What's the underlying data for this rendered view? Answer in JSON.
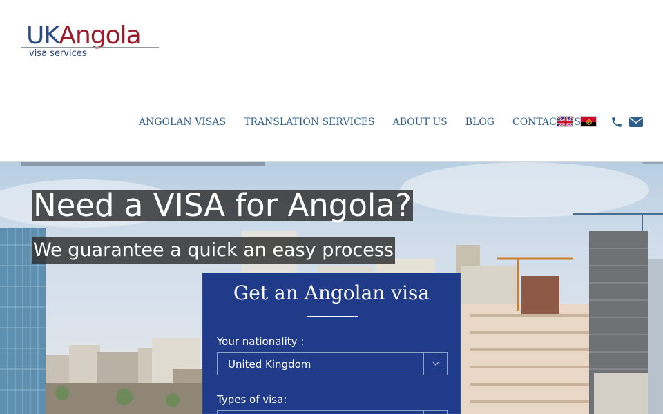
{
  "brand": {
    "logo_main_uk": "UK",
    "logo_main_angola": "Angola",
    "logo_sub": "visa services"
  },
  "nav": {
    "items": [
      "ANGOLAN VISAS",
      "TRANSLATION SERVICES",
      "ABOUT US",
      "BLOG",
      "CONTACT US"
    ]
  },
  "icons": {
    "flag_uk": "uk-flag-icon",
    "flag_angola": "angola-flag-icon",
    "phone": "phone-icon",
    "mail": "envelope-icon"
  },
  "hero": {
    "title": "Need a VISA for Angola?",
    "subtitle": "We guarantee a quick an easy process"
  },
  "visa_form": {
    "title": "Get an Angolan visa",
    "nationality_label": "Your nationality :",
    "nationality_value": "United Kingdom",
    "type_label": "Types of visa:",
    "type_value": ""
  },
  "colors": {
    "nav_text": "#2d5f8c",
    "form_bg": "#1f3b8a",
    "logo_blue": "#2a4a80",
    "logo_red": "#9c1b2a"
  }
}
